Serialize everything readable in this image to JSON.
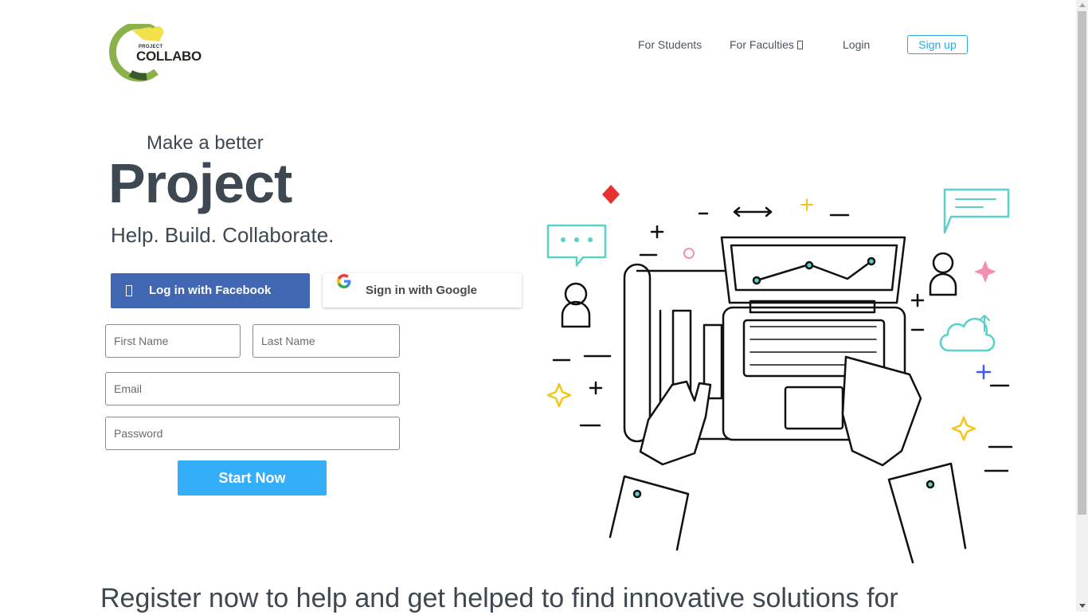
{
  "brand": {
    "logo_small": "PROJECT",
    "logo_big": "COLLABO",
    "colors": {
      "green": "#8bb24a",
      "dark_green": "#3a5a2a",
      "yellow": "#f2e14a"
    }
  },
  "nav": {
    "students": "For Students",
    "faculties": "For Faculties",
    "faculties_icon": "caret-icon",
    "login": "Login",
    "signup": "Sign up"
  },
  "hero": {
    "line1": "Make a better",
    "line2": "Project",
    "line3": "Help. Build. Collaborate."
  },
  "social": {
    "facebook_label": "Log in with Facebook",
    "facebook_icon": "facebook-icon",
    "google_label": "Sign in with Google",
    "google_icon": "google-icon"
  },
  "form": {
    "first_name_placeholder": "First Name",
    "last_name_placeholder": "Last Name",
    "email_placeholder": "Email",
    "password_placeholder": "Password",
    "submit_label": "Start Now"
  },
  "footer_headline": "Register now to help and get helped to find innovative solutions for",
  "theme": {
    "accent": "#35aefa",
    "facebook": "#4267b2",
    "text": "#3d4852",
    "signup_border": "#29a8e0"
  }
}
